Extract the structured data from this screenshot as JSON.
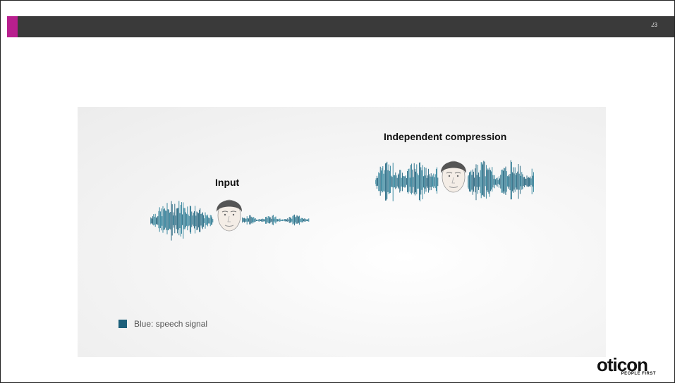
{
  "header": {
    "page_number": "23",
    "accent_color": "#b81f8e",
    "bar_color": "#3a3a3a"
  },
  "panels": {
    "input": {
      "label": "Input",
      "icon": "face-icon"
    },
    "compression": {
      "label": "Independent compression",
      "icon": "face-icon"
    }
  },
  "legend": {
    "swatch_color": "#1c5f7a",
    "text": "Blue: speech signal"
  },
  "logo": {
    "name": "oticon",
    "tagline": "PEOPLE FIRST"
  }
}
